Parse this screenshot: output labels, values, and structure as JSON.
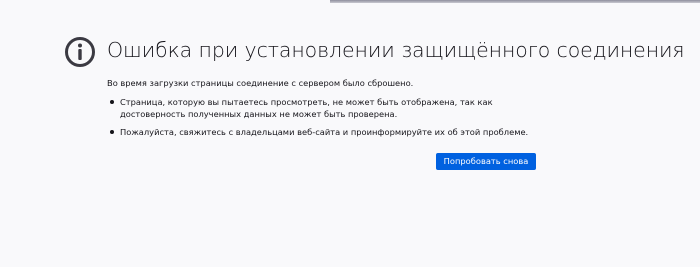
{
  "error_page": {
    "icon": "info-icon",
    "title": "Ошибка при установлении защищённого соединения",
    "intro": "Во время загрузки страницы соединение с сервером было сброшено.",
    "bullets": [
      {
        "text": "Страница, которую вы пытаетесь просмотреть, не может быть отображена, так как достоверность полученных данных не может быть проверена."
      },
      {
        "text": "Пожалуйста, свяжитесь с владельцами веб-сайта и проинформируйте их об этой проблеме."
      }
    ],
    "retry_label": "Попробовать снова"
  },
  "colors": {
    "background": "#f9f9fb",
    "text": "#15141a",
    "icon": "#3b3a42",
    "button": "#0061e0",
    "button_text": "#ffffff"
  }
}
